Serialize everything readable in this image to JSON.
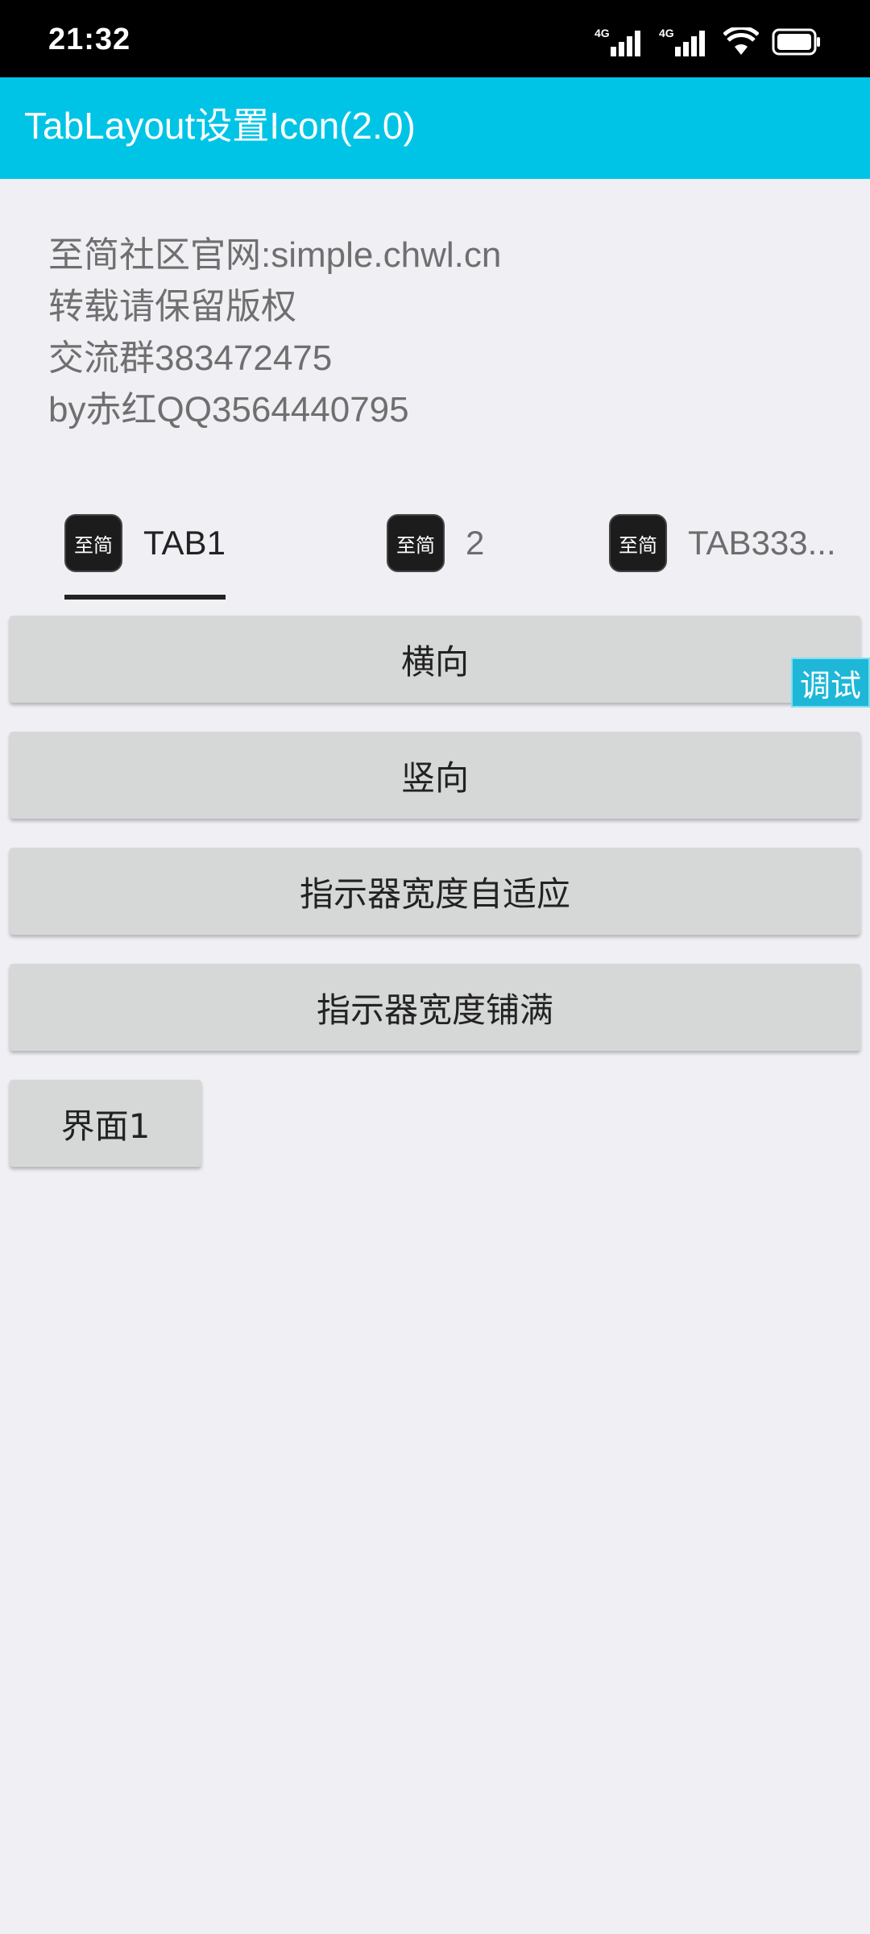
{
  "status_bar": {
    "time": "21:32",
    "signal1": "4G",
    "signal2": "4G"
  },
  "app_bar": {
    "title": "TabLayout设置Icon(2.0)"
  },
  "info": {
    "line1": "至简社区官网:simple.chwl.cn",
    "line2": "转载请保留版权",
    "line3": "交流群383472475",
    "line4": "by赤红QQ3564440795"
  },
  "tabs": [
    {
      "icon_text": "至简",
      "label": "TAB1",
      "selected": true
    },
    {
      "icon_text": "至简",
      "label": "2",
      "selected": false
    },
    {
      "icon_text": "至简",
      "label": "TAB333...",
      "selected": false
    }
  ],
  "buttons": {
    "horizontal": "横向",
    "vertical": "竖向",
    "indicator_adaptive": "指示器宽度自适应",
    "indicator_fill": "指示器宽度铺满",
    "page1": "界面1"
  },
  "debug_badge": "调试",
  "colors": {
    "app_bar": "#00c4e6",
    "background": "#efeff4",
    "button": "#d6d7d7",
    "debug_badge": "#1fb7d8"
  },
  "icons": {
    "signal": "cellular-signal-icon",
    "wifi": "wifi-icon",
    "battery": "battery-icon"
  }
}
